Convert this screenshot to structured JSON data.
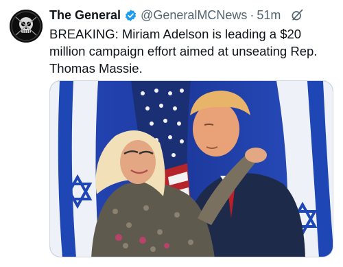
{
  "author": {
    "display_name": "The General",
    "handle": "@GeneralMCNews",
    "separator": "·",
    "timestamp": "51m"
  },
  "tweet": {
    "text": "BREAKING: Miriam Adelson is leading a $20 million campaign effort aimed at unseating Rep. Thomas Massie."
  },
  "icons": {
    "verified": "verified-badge-icon",
    "grok": "grok-icon"
  },
  "colors": {
    "text_primary": "#0f1419",
    "text_secondary": "#536471",
    "verified_blue": "#1d9bf0",
    "flag_blue": "#1f3fa8",
    "border": "#cfd9de"
  }
}
